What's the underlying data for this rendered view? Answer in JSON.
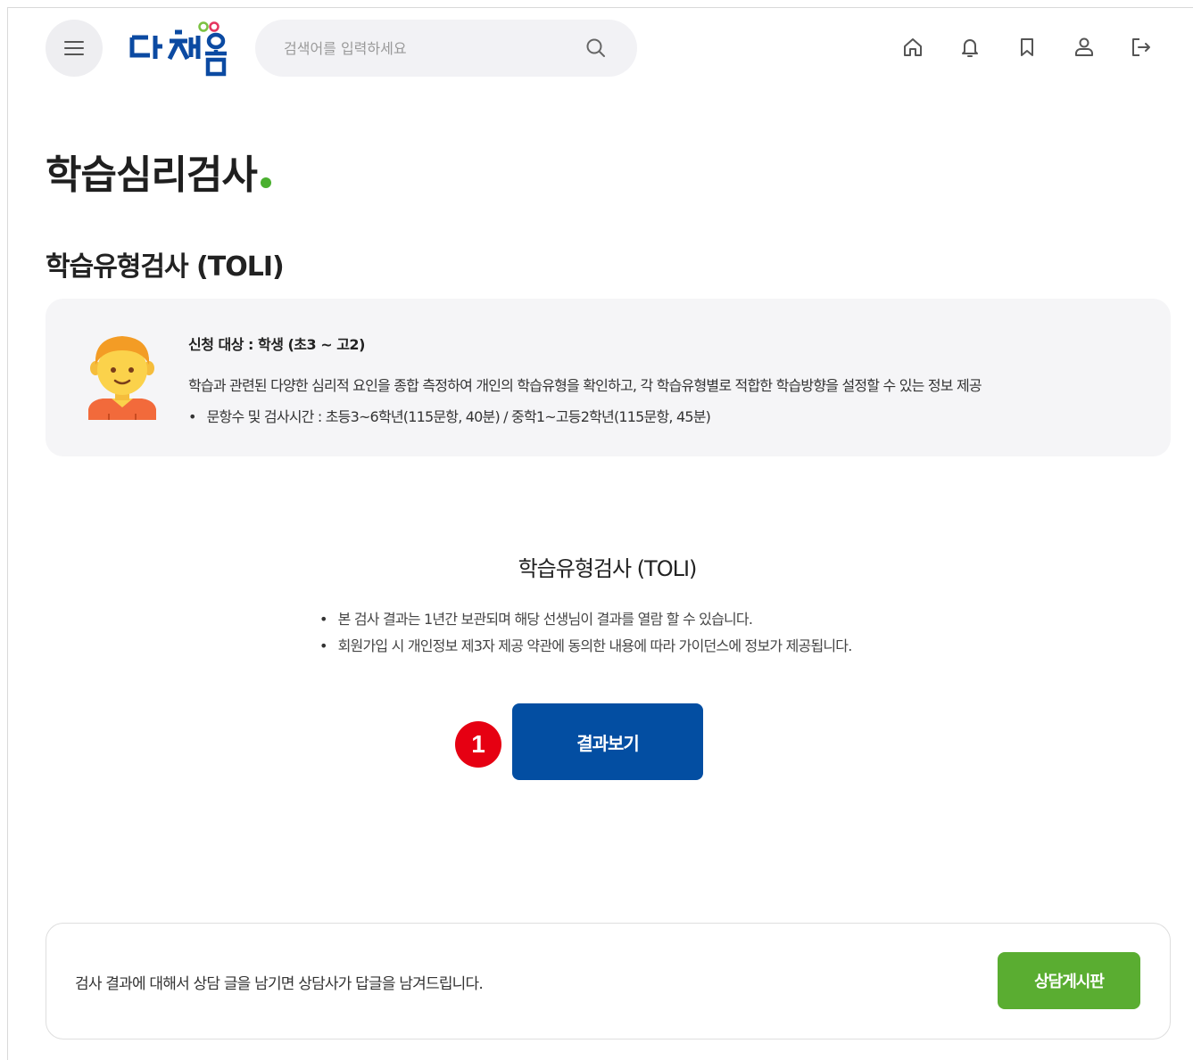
{
  "header": {
    "logo_text": "다채움",
    "search": {
      "placeholder": "검색어를 입력하세요",
      "value": ""
    },
    "icons": [
      "menu-icon",
      "search-icon",
      "home-icon",
      "bell-icon",
      "bookmark-icon",
      "user-icon",
      "logout-icon"
    ]
  },
  "page": {
    "title": "학습심리검사",
    "section_title": "학습유형검사 (TOLI)"
  },
  "info_card": {
    "avatar_icon": "student-avatar-icon",
    "target": "신청 대상 : 학생 (초3 ~ 고2)",
    "description": "학습과 관련된 다양한 심리적 요인을 종합 측정하여 개인의 학습유형을 확인하고, 각 학습유형별로 적합한 학습방향을 설정할 수 있는 정보 제공",
    "bullet": "문항수 및 검사시간 : 초등3~6학년(115문항, 40분) / 중학1~고등2학년(115문항, 45분)"
  },
  "result": {
    "title": "학습유형검사 (TOLI)",
    "notes": [
      "본 검사 결과는 1년간 보관되며 해당 선생님이 결과를 열람 할 수 있습니다.",
      "회원가입 시 개인정보 제3자 제공 약관에 동의한 내용에 따라 가이던스에 정보가 제공됩니다."
    ],
    "step_number": "1",
    "button_label": "결과보기"
  },
  "counsel": {
    "text": "검사 결과에 대해서 상담 글을 남기면 상담사가 답글을 남겨드립니다.",
    "button_label": "상담게시판"
  },
  "colors": {
    "primary_blue": "#034ea2",
    "accent_green": "#5aad31",
    "step_red": "#e60012",
    "card_bg": "#f5f5f7"
  }
}
